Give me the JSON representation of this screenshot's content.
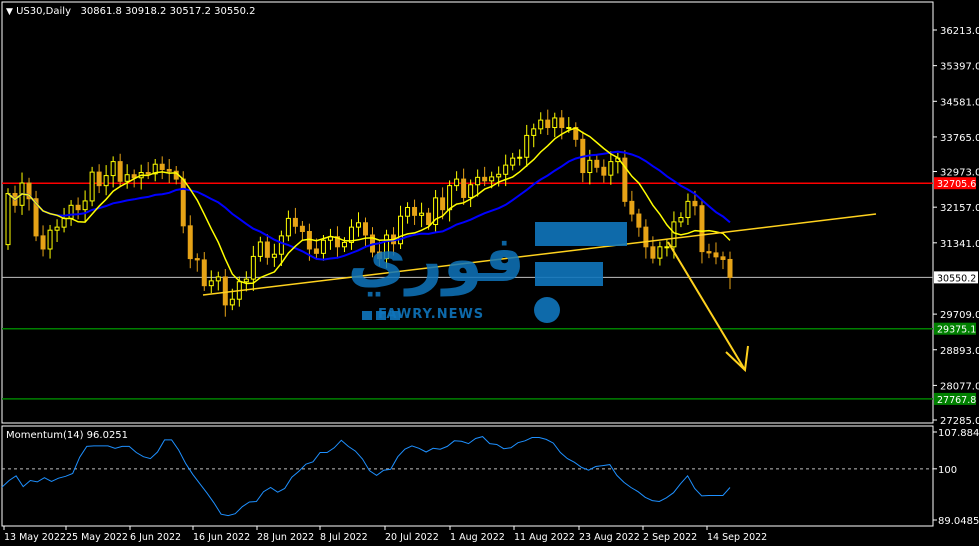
{
  "header": {
    "menu_icon": "triangle-down-icon",
    "title": "US30,Daily",
    "ohlc": "30861.8 30918.2 30517.2 30550.2"
  },
  "price_axis": {
    "ticks": [
      "36213.0",
      "35397.0",
      "34581.0",
      "33765.0",
      "32973.0",
      "32157.0",
      "31341.0",
      "30550.2",
      "29709.0",
      "28893.0",
      "28077.0",
      "27285.0"
    ],
    "current": "30550.2",
    "levels": [
      {
        "label": "32705.6",
        "color": "#ff0000"
      },
      {
        "label": "29375.1",
        "color": "#008000"
      },
      {
        "label": "27767.8",
        "color": "#008000"
      }
    ]
  },
  "momentum": {
    "label": "Momentum(14) 96.0251",
    "ticks": [
      "107.884",
      "100",
      "89.0485"
    ]
  },
  "time_axis": {
    "ticks": [
      "13 May 2022",
      "25 May 2022",
      "6 Jun 2022",
      "16 Jun 2022",
      "28 Jun 2022",
      "8 Jul 2022",
      "20 Jul 2022",
      "1 Aug 2022",
      "11 Aug 2022",
      "23 Aug 2022",
      "2 Sep 2022",
      "14 Sep 2022"
    ]
  },
  "watermark": {
    "arabic": "فوري",
    "latin": "FAWRY.NEWS"
  },
  "colors": {
    "bull": "#ffff00",
    "bear": "#e6a317",
    "ma_fast": "#ffff00",
    "ma_slow": "#0000ff",
    "momentum_line": "#1e90ff",
    "trendline": "#ffd21e",
    "brand": "#0f75bc"
  },
  "chart_data": [
    {
      "type": "candlestick",
      "title": "US30,Daily",
      "y_axis_ticks": [
        36213.0,
        35397.0,
        34581.0,
        33765.0,
        32973.0,
        32157.0,
        31341.0,
        30550.2,
        29709.0,
        28893.0,
        28077.0,
        27285.0
      ],
      "horizontal_levels": [
        32705.6,
        29375.1,
        27767.8
      ],
      "last_close": 30550.2,
      "closes": [
        32470,
        32200,
        32710,
        32350,
        31500,
        31200,
        31630,
        31700,
        31900,
        32200,
        32100,
        32300,
        32960,
        32650,
        32880,
        33200,
        32750,
        32900,
        32830,
        32950,
        32920,
        33140,
        33020,
        32980,
        32800,
        31730,
        30980,
        30950,
        30360,
        30470,
        30560,
        29920,
        30050,
        30450,
        30510,
        31030,
        31360,
        31010,
        31080,
        31500,
        31900,
        31720,
        31600,
        31200,
        31100,
        31400,
        31480,
        31250,
        31350,
        31700,
        31800,
        31520,
        31130,
        30980,
        31520,
        31320,
        31950,
        32150,
        31970,
        32020,
        31760,
        32370,
        32100,
        32650,
        32800,
        32380,
        32670,
        32840,
        32760,
        32850,
        32910,
        33120,
        33280,
        33300,
        33800,
        33950,
        34150,
        33980,
        34200,
        33980,
        33980,
        33710,
        32950,
        33230,
        33070,
        32890,
        33200,
        33280,
        32290,
        32000,
        31700,
        31250,
        30990,
        31250,
        31250,
        31820,
        31920,
        32290,
        32190,
        31140,
        31110,
        31020,
        30960,
        30550
      ],
      "ma_fast_shape": "rises from ~31.3k early May to ~33k early Jun, falls to ~30.8k mid-Jun, rises to ~33.9k mid-Aug, falls to ~31.2k mid-Sep",
      "ma_slow_shape": "from ~32.8k in May down to ~31.4k in late Jun, up to ~33.1k in late Aug, down to ~32.0k in mid-Sep",
      "x_tick_labels": [
        "13 May 2022",
        "25 May 2022",
        "6 Jun 2022",
        "16 Jun 2022",
        "28 Jun 2022",
        "8 Jul 2022",
        "20 Jul 2022",
        "1 Aug 2022",
        "11 Aug 2022",
        "23 Aug 2022",
        "2 Sep 2022",
        "14 Sep 2022"
      ]
    },
    {
      "type": "line",
      "title": "Momentum(14) 96.0251",
      "y_axis_ticks": [
        107.884,
        100,
        89.0485
      ],
      "reference_line": 100,
      "last_value": 96.0251,
      "values": [
        96.1,
        97.5,
        98.5,
        96.2,
        97.5,
        97.2,
        98.1,
        97.3,
        98.0,
        98.4,
        99.0,
        102.5,
        104.8,
        104.9,
        104.9,
        104.9,
        104.4,
        104.8,
        104.8,
        103.5,
        102.6,
        102.2,
        103.6,
        106.2,
        106.2,
        104.0,
        101.1,
        98.8,
        96.8,
        94.8,
        92.7,
        90.3,
        90.0,
        90.4,
        91.9,
        92.9,
        93.0,
        95.1,
        96.0,
        95.0,
        95.8,
        98.2,
        99.5,
        101.0,
        101.5,
        103.5,
        103.5,
        104.5,
        106.1,
        104.8,
        103.8,
        102.1,
        99.6,
        98.6,
        99.7,
        99.9,
        102.6,
        104.2,
        104.9,
        104.4,
        103.6,
        104.4,
        104.2,
        104.8,
        106.0,
        105.9,
        105.4,
        106.5,
        106.9,
        105.4,
        105.2,
        104.3,
        104.5,
        105.6,
        106.0,
        106.7,
        106.7,
        106.3,
        105.5,
        103.5,
        102.2,
        101.4,
        100.3,
        99.7,
        100.5,
        100.7,
        100.9,
        98.6,
        97.1,
        96.0,
        95.1,
        93.9,
        93.2,
        93.0,
        93.8,
        94.9,
        96.8,
        98.5,
        95.8,
        94.2,
        94.3,
        94.3,
        94.3,
        96.0
      ]
    }
  ]
}
